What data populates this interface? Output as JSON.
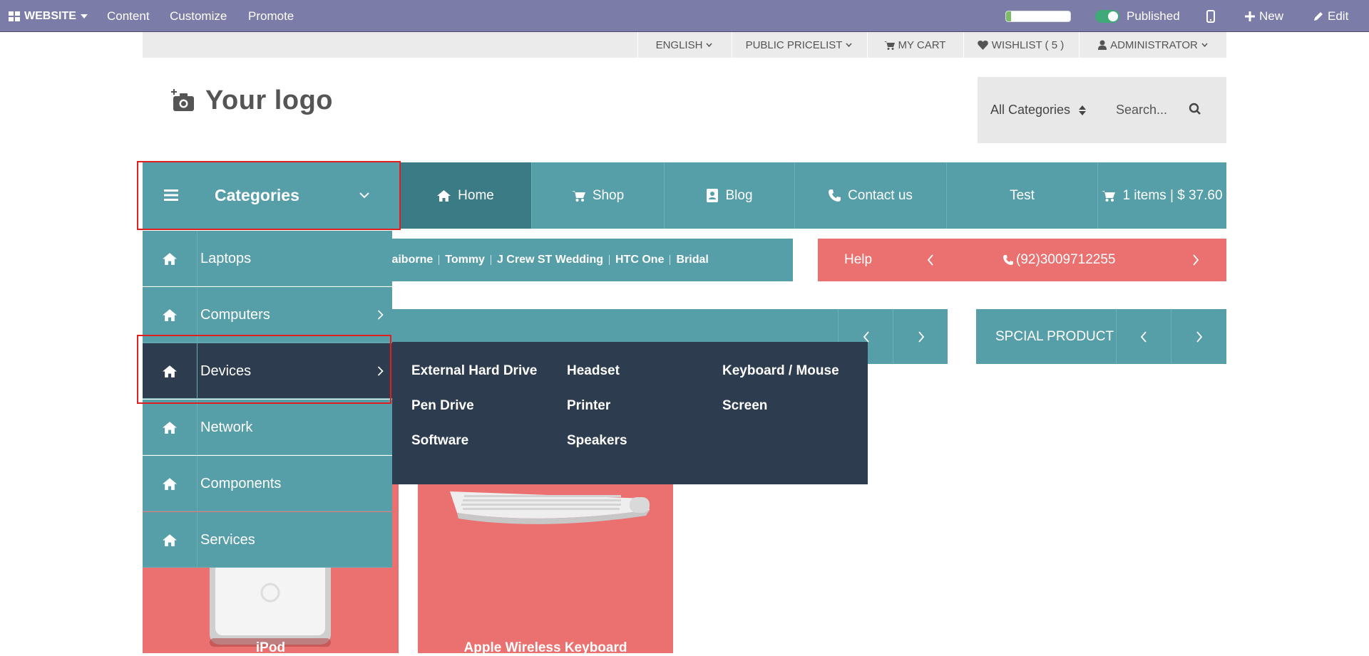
{
  "colors": {
    "admin_bar": "#7b7ca8",
    "teal": "#569ea8",
    "teal_dark": "#3b7b86",
    "coral": "#ea7170",
    "navy": "#2d3d4f",
    "highlight": "#e02020"
  },
  "admin_bar": {
    "website_label": "WEBSITE",
    "menu": [
      "Content",
      "Customize",
      "Promote"
    ],
    "progress": 0.08,
    "published_label": "Published",
    "new_label": "New",
    "edit_label": "Edit"
  },
  "top_bar": {
    "language": "ENGLISH",
    "pricelist": "PUBLIC PRICELIST",
    "cart": "MY CART",
    "wishlist": "WISHLIST ( 5 )",
    "user": "ADMINISTRATOR"
  },
  "header": {
    "logo_text": "Your logo",
    "category_select": "All Categories",
    "search_placeholder": "Search..."
  },
  "nav": {
    "categories_label": "Categories",
    "items": [
      "Home",
      "Shop",
      "Blog",
      "Contact us",
      "Test"
    ],
    "cart_summary": "1 items | $ 37.60"
  },
  "tags_bar": {
    "tags": [
      "laiborne",
      "Tommy",
      "J Crew ST Wedding",
      "HTC One",
      "Bridal"
    ]
  },
  "help_bar": {
    "label": "Help",
    "phone": "(92)3009712255"
  },
  "special": {
    "label": "SPCIAL PRODUCT"
  },
  "categories": [
    {
      "label": "Laptops",
      "has_children": false
    },
    {
      "label": "Computers",
      "has_children": true
    },
    {
      "label": "Devices",
      "has_children": true
    },
    {
      "label": "Network",
      "has_children": false
    },
    {
      "label": "Components",
      "has_children": false
    },
    {
      "label": "Services",
      "has_children": false
    }
  ],
  "devices_submenu": [
    "External Hard Drive",
    "Headset",
    "Keyboard / Mouse",
    "Pen Drive",
    "Printer",
    "Screen",
    "Software",
    "Speakers"
  ],
  "products": [
    {
      "name": "iPod"
    },
    {
      "name": "Apple Wireless Keyboard"
    }
  ]
}
